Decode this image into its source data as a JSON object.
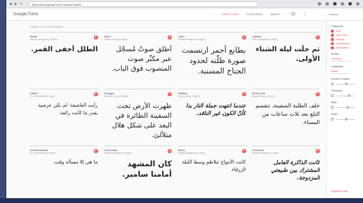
{
  "browser": {
    "url": "https://fonts.google.com/?subset=arabic",
    "back": "◀",
    "forward": "▶",
    "reload": "↻"
  },
  "header": {
    "brand": "Google Fonts",
    "nav": [
      "DIRECTORY",
      "FEATURED",
      "ABOUT"
    ],
    "search_label": "Search"
  },
  "toolbar": {
    "text": "Viewing 16 of 915 font families"
  },
  "fonts": [
    {
      "name": "Mada",
      "meta": "Multiple designers (7 styles)",
      "sample": "الطلل أخفى القمر.",
      "style": "s1"
    },
    {
      "name": "Amiri",
      "meta": "Khaled Hosny (4 styles)",
      "sample": "أطلق صوتٌ مُسجّل عبر مكبِّر صوت المنصوب فوق الباب.",
      "style": "s2"
    },
    {
      "name": "Cairo",
      "meta": "Multiple designers (6 styles)",
      "sample": "بطابع أحمر ارتسمت صورة ظلّته لحدود الجناح المسننة.",
      "style": "s3"
    },
    {
      "name": "Lalezar",
      "meta": "Borna Izadpanah (1 style)",
      "sample": "ثم حلّت ليلة الشتاء الأولى.",
      "style": "s1"
    },
    {
      "name": "Lateef",
      "meta": "SIL International (1 style)",
      "sample": "رأيت العاصفة؛ لم تكن عرضية بقدر ما كانت رائعة.",
      "style": "s5"
    },
    {
      "name": "Changa",
      "meta": "Eduardo Tunni (7 styles)",
      "sample": "ظهرت الأرض تحت السفينة الطائرة في البعد على شكل هلال متلألئ.",
      "style": "s3"
    },
    {
      "name": "Rakkas",
      "meta": "Zeynep Akay (1 style)",
      "sample": "عندما انتهت جملة النار بدا كأنّ الكون غير الناقد.",
      "style": "s6"
    },
    {
      "name": "Reem Kufi",
      "meta": "Khaled Hosny (1 style)",
      "sample": "خلف الطلبة السفينة، تنقسم التلع بعد ثلاث ساعات من المساء.",
      "style": "s4"
    },
    {
      "name": "Scheherazade",
      "meta": "SIL International (2 styles)",
      "sample": "ما هي إلا مسألة وقت.",
      "style": "s5"
    },
    {
      "name": "Lemonada",
      "meta": "Multiple designers (4 styles)",
      "sample": "كان المشهد أمامنا سامير.",
      "style": "s7"
    },
    {
      "name": "Mirza",
      "meta": "Multiple designers (4 styles)",
      "sample": "كانت الأمواج تتلاطم وسط الليلة الزرقاء.",
      "style": "s5"
    },
    {
      "name": "Jomhuria",
      "meta": "Multiple designers (1 style)",
      "sample": "كانت الذاكرة العامل المشترك بين طبيعتي المزدوجة.",
      "style": "s6"
    }
  ],
  "sidebar": {
    "categories_title": "Categories",
    "categories": [
      "Serif",
      "Sans Serif",
      "Display",
      "Handwriting",
      "Monospace"
    ],
    "sorting_title": "Sorting",
    "sorting_value": "Trending",
    "languages_title": "Languages",
    "languages_value": "Arabic",
    "filters": [
      "Number of styles",
      "Thickness",
      "Slant",
      "Width"
    ],
    "link": "Suggest to Help"
  },
  "colors": {
    "accent": "#ef5350"
  }
}
